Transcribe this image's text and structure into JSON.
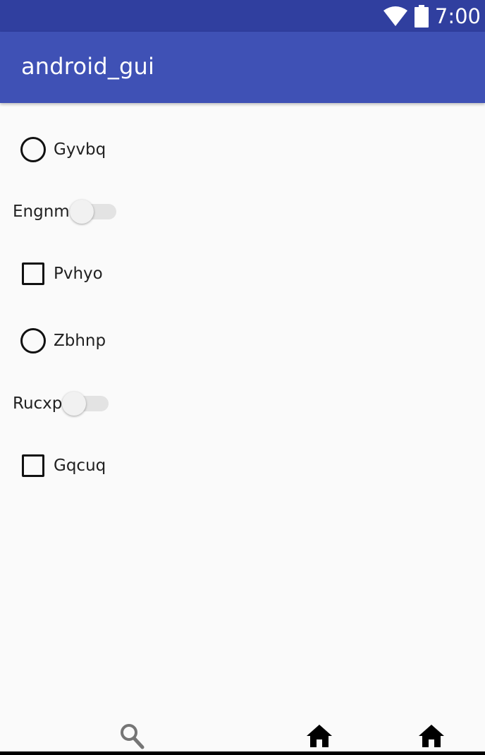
{
  "status_bar": {
    "time": "7:00",
    "icons": [
      "wifi-icon",
      "battery-icon"
    ]
  },
  "app_bar": {
    "title": "android_gui"
  },
  "controls": [
    {
      "type": "radio",
      "label": "Gyvbq",
      "checked": false
    },
    {
      "type": "switch",
      "label": "Engnm",
      "on": false
    },
    {
      "type": "checkbox",
      "label": "Pvhyo",
      "checked": false
    },
    {
      "type": "radio",
      "label": "Zbhnp",
      "checked": false
    },
    {
      "type": "switch",
      "label": "Rucxp",
      "on": false
    },
    {
      "type": "checkbox",
      "label": "Gqcuq",
      "checked": false
    }
  ],
  "bottom_nav": {
    "icons": [
      "search-icon",
      "home-icon",
      "home-icon"
    ]
  },
  "colors": {
    "status_bar": "#303f9f",
    "app_bar": "#3f51b5",
    "background": "#fafafa"
  }
}
